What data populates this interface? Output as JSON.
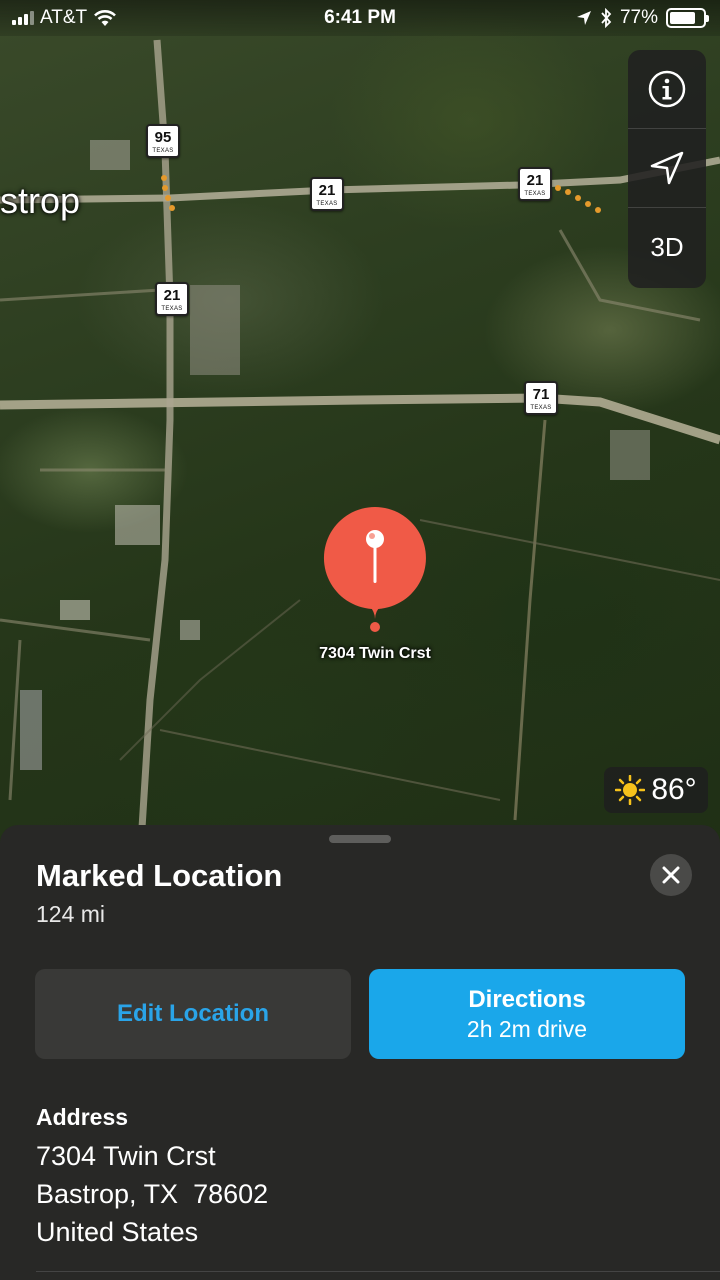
{
  "status_bar": {
    "carrier": "AT&T",
    "time": "6:41 PM",
    "battery_text": "77%",
    "battery_level": 0.77
  },
  "map": {
    "town_label": "strop",
    "route_shields": [
      {
        "number": "95",
        "state": "TEXAS"
      },
      {
        "number": "21",
        "state": "TEXAS"
      },
      {
        "number": "21",
        "state": "TEXAS"
      },
      {
        "number": "21",
        "state": "TEXAS"
      },
      {
        "number": "71",
        "state": "TEXAS"
      }
    ],
    "pin_label": "7304 Twin Crst",
    "pin_color": "#f05a47",
    "controls": {
      "info_icon": "info-icon",
      "location_icon": "location-arrow-icon",
      "view_3d_label": "3D"
    },
    "weather": {
      "icon": "sun-icon",
      "temperature": "86°"
    }
  },
  "place_card": {
    "title": "Marked Location",
    "distance": "124 mi",
    "edit_button_label": "Edit Location",
    "directions_button_label": "Directions",
    "directions_button_sublabel": "2h 2m drive",
    "address_heading": "Address",
    "address_lines": [
      "7304 Twin Crst",
      "Bastrop, TX  78602",
      "United States"
    ],
    "accent_color": "#1aa7ea"
  }
}
